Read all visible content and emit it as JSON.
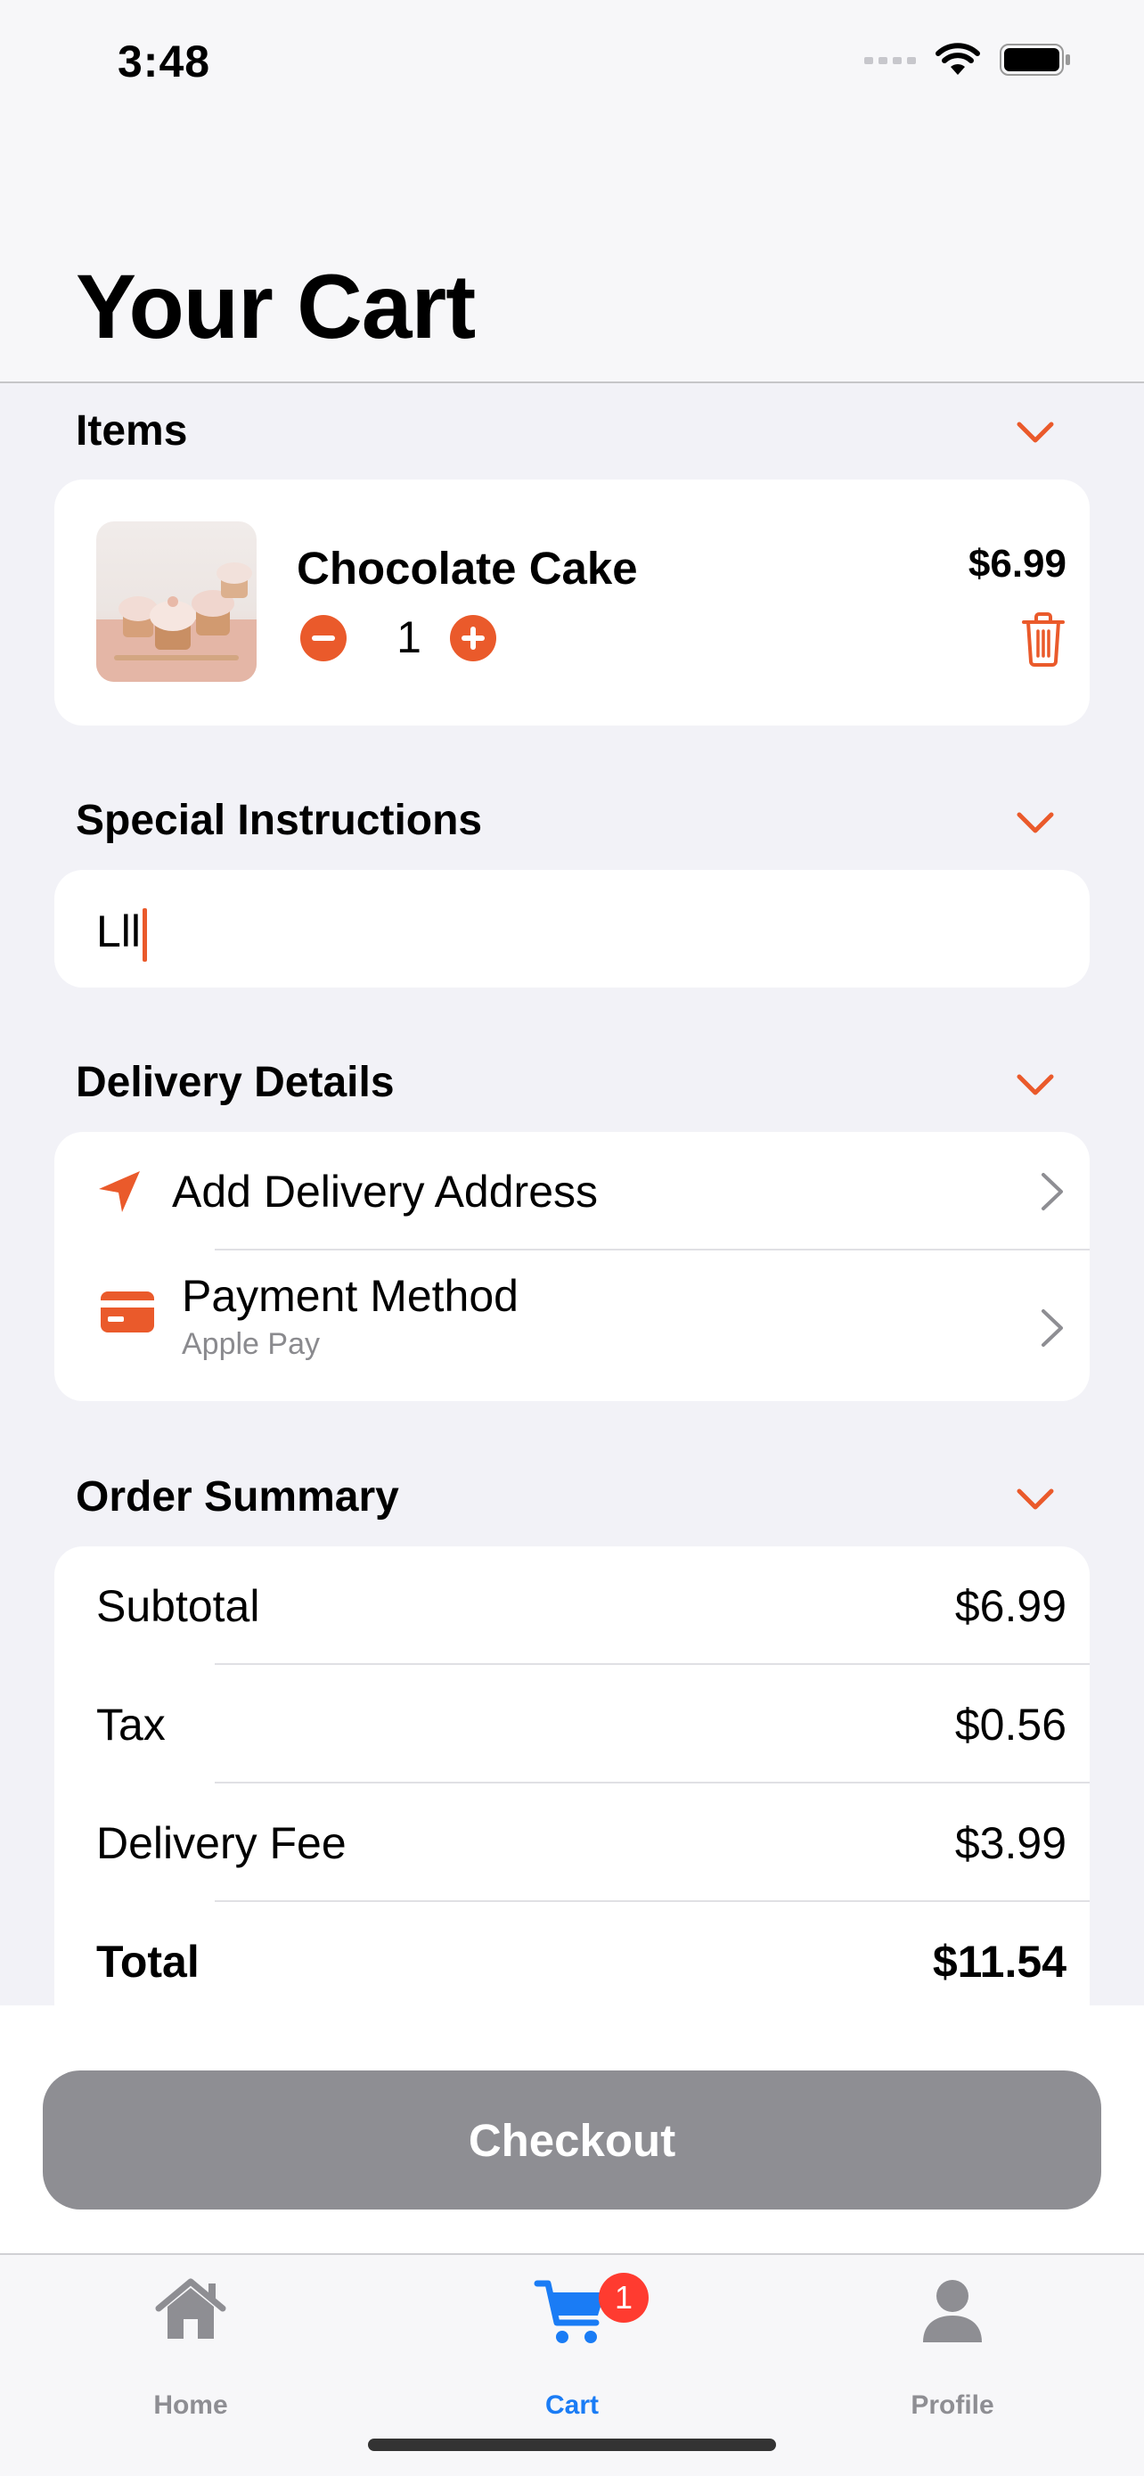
{
  "status_bar": {
    "time": "3:48"
  },
  "header": {
    "title": "Your Cart"
  },
  "sections": {
    "items": "Items",
    "special_instructions": "Special Instructions",
    "delivery_details": "Delivery Details",
    "order_summary": "Order Summary"
  },
  "cart_item": {
    "name": "Chocolate Cake",
    "price": "$6.99",
    "quantity": "1"
  },
  "special_instructions": {
    "value": "Lll"
  },
  "delivery": {
    "address_label": "Add Delivery Address",
    "payment_label": "Payment Method",
    "payment_value": "Apple Pay"
  },
  "summary": {
    "subtotal_label": "Subtotal",
    "subtotal": "$6.99",
    "tax_label": "Tax",
    "tax": "$0.56",
    "delivery_label": "Delivery Fee",
    "delivery_fee": "$3.99",
    "total_label": "Total",
    "total": "$11.54"
  },
  "checkout": {
    "label": "Checkout"
  },
  "tabs": [
    {
      "label": "Home",
      "icon": "house-icon",
      "active": false
    },
    {
      "label": "Cart",
      "icon": "cart-icon",
      "active": true,
      "badge": "1"
    },
    {
      "label": "Profile",
      "icon": "person-icon",
      "active": false
    }
  ],
  "colors": {
    "accent": "#ea5a2b",
    "tab_active": "#1a7cf5",
    "tab_inactive": "#8e8e93",
    "badge": "#ff3b30",
    "checkout_disabled": "#8e8e93"
  }
}
